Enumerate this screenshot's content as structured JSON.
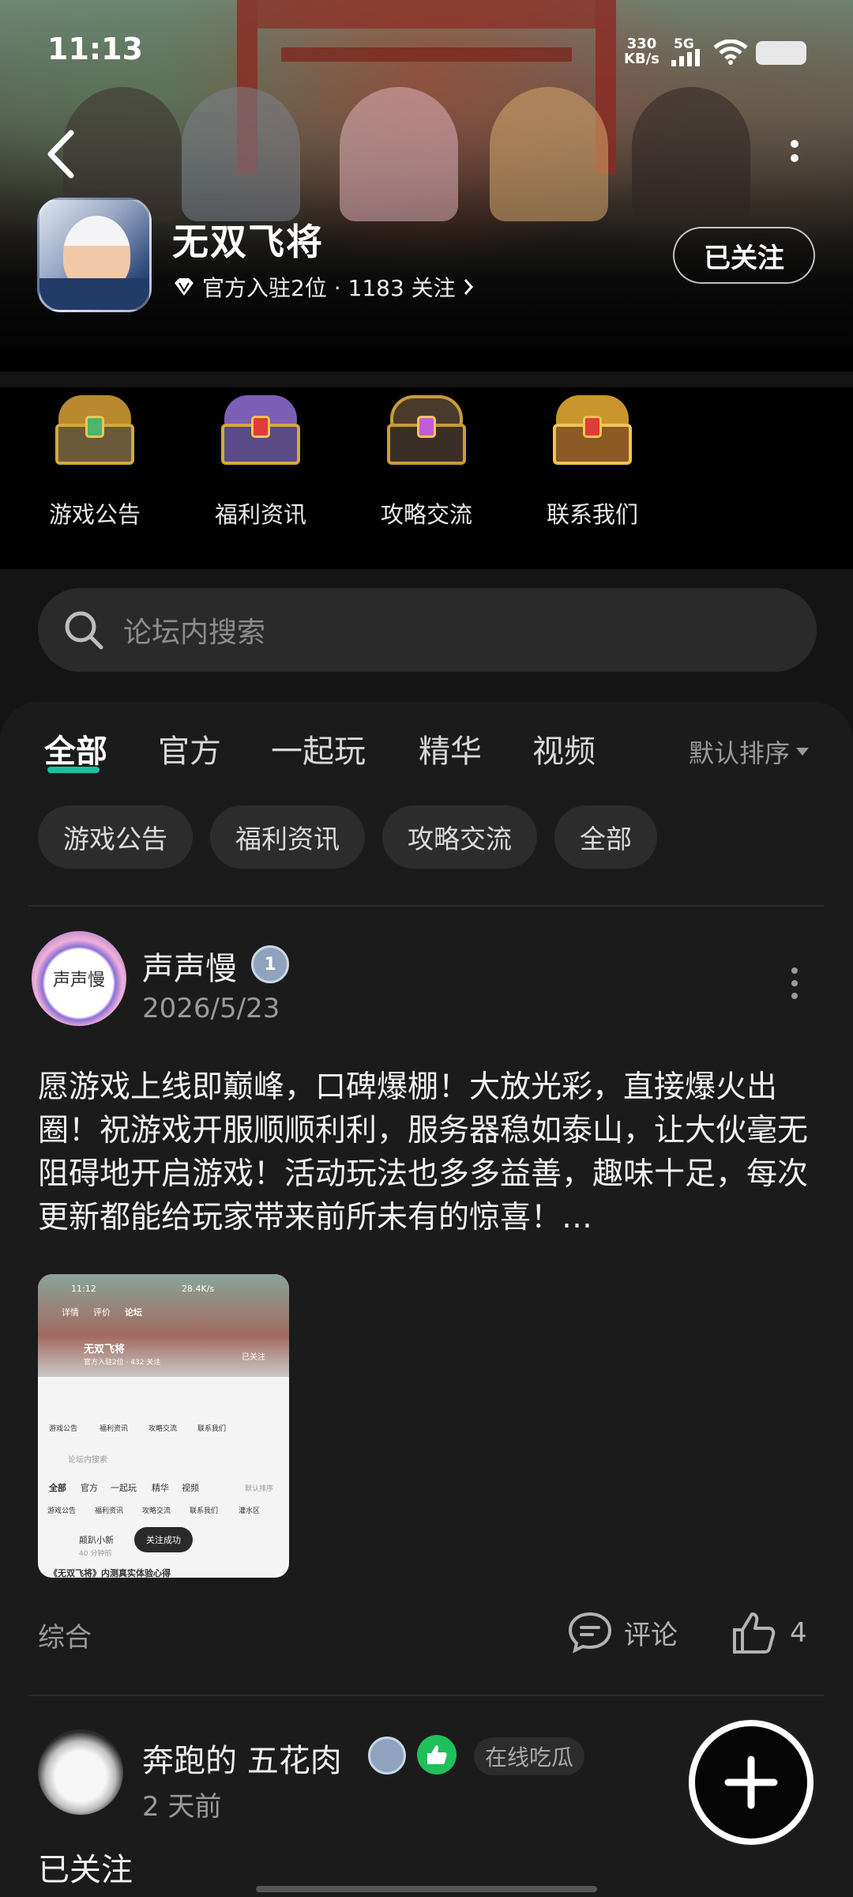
{
  "status_bar": {
    "time": "11:13",
    "net_speed_value": "330",
    "net_speed_unit": "KB/s",
    "network": "5G"
  },
  "forum": {
    "title": "无双飞将",
    "meta": "官方入驻2位 · 1183 关注",
    "follow_label": "已关注"
  },
  "categories": [
    {
      "label": "游戏公告",
      "icon": "golden-chest-icon"
    },
    {
      "label": "福利资讯",
      "icon": "purple-chest-icon"
    },
    {
      "label": "攻略交流",
      "icon": "open-chest-icon"
    },
    {
      "label": "联系我们",
      "icon": "red-gold-chest-icon"
    }
  ],
  "search": {
    "placeholder": "论坛内搜索"
  },
  "tabs": [
    "全部",
    "官方",
    "一起玩",
    "精华",
    "视频"
  ],
  "sort_label": "默认排序",
  "chips": [
    "游戏公告",
    "福利资讯",
    "攻略交流",
    "全部"
  ],
  "post1": {
    "author": "声声慢",
    "avatar_text": "声声慢",
    "level": "1",
    "date": "2026/5/23",
    "text": "愿游戏上线即巅峰，口碑爆棚！大放光彩，直接爆火出圈！祝游戏开服顺顺利利，服务器稳如泰山，让大伙毫无阻碍地开启游戏！活动玩法也多多益善，趣味十足，每次更新都能给玩家带来前所未有的惊喜！…",
    "thumbnail": {
      "time": "11:12",
      "speed": "28.4K/s",
      "nav": [
        "详情",
        "评价",
        "论坛"
      ],
      "title": "无双飞将",
      "meta": "官方入驻2位 · 432 关注",
      "follow": "已关注",
      "cats": [
        "游戏公告",
        "福利资讯",
        "攻略交流",
        "联系我们"
      ],
      "search": "论坛内搜索",
      "tabs": [
        "全部",
        "官方",
        "一起玩",
        "精华",
        "视频"
      ],
      "sort": "默认排序",
      "chips": [
        "游戏公告",
        "福利资讯",
        "攻略交流",
        "联系我们",
        "灌水区"
      ],
      "user": "颠趴小新",
      "user_time": "40 分钟前",
      "toast": "关注成功",
      "post_title": "《无双飞将》内测真实体验心得"
    },
    "category": "综合",
    "comment_label": "评论",
    "like_count": "4"
  },
  "post2": {
    "author": "奔跑的 五花肉",
    "tag": "在线吃瓜",
    "date": "2 天前",
    "text": "已关注"
  },
  "colors": {
    "accent": "#17c1a4",
    "background": "#1b1b1b",
    "like_badge": "#1fbf5c"
  }
}
